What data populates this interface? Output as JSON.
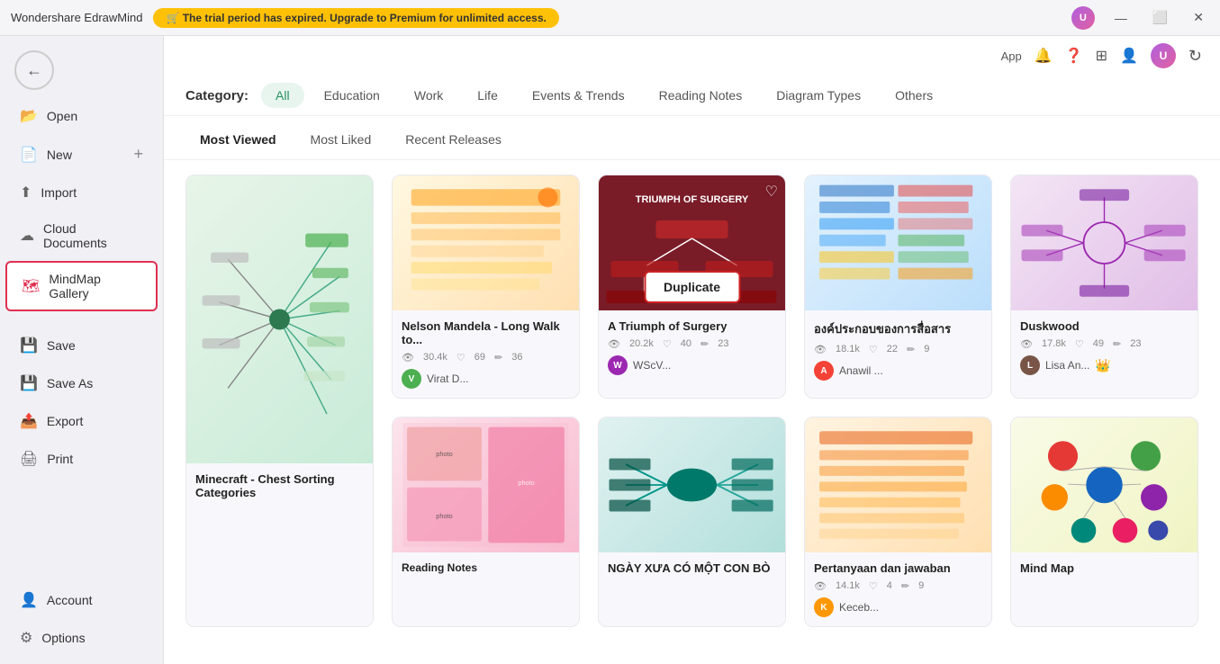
{
  "titlebar": {
    "app_name": "Wondershare EdrawMind",
    "upgrade_text": "🛒 The trial period has expired. Upgrade to Premium for unlimited access.",
    "win_btns": [
      "—",
      "⬜",
      "✕"
    ]
  },
  "toolbar": {
    "app_label": "App",
    "icons": [
      "🔔",
      "❓",
      "⊞",
      "👤"
    ]
  },
  "sidebar": {
    "items": [
      {
        "id": "open",
        "label": "Open",
        "icon": "📂"
      },
      {
        "id": "new",
        "label": "New",
        "icon": "📄",
        "extra": "+"
      },
      {
        "id": "import",
        "label": "Import",
        "icon": "⬆"
      },
      {
        "id": "cloud",
        "label": "Cloud Documents",
        "icon": "☁"
      },
      {
        "id": "gallery",
        "label": "MindMap Gallery",
        "icon": "🗺",
        "active": true
      }
    ],
    "bottom_items": [
      {
        "id": "save",
        "label": "Save",
        "icon": "💾"
      },
      {
        "id": "saveas",
        "label": "Save As",
        "icon": "💾"
      },
      {
        "id": "export",
        "label": "Export",
        "icon": "📤"
      },
      {
        "id": "print",
        "label": "Print",
        "icon": "🖨"
      }
    ],
    "footer_items": [
      {
        "id": "account",
        "label": "Account",
        "icon": "👤"
      },
      {
        "id": "options",
        "label": "Options",
        "icon": "⚙"
      }
    ]
  },
  "category": {
    "label": "Category:",
    "items": [
      {
        "id": "all",
        "label": "All",
        "active": true
      },
      {
        "id": "education",
        "label": "Education"
      },
      {
        "id": "work",
        "label": "Work"
      },
      {
        "id": "life",
        "label": "Life"
      },
      {
        "id": "events",
        "label": "Events & Trends"
      },
      {
        "id": "reading",
        "label": "Reading Notes"
      },
      {
        "id": "diagram",
        "label": "Diagram Types"
      },
      {
        "id": "others",
        "label": "Others"
      }
    ]
  },
  "filters": {
    "items": [
      {
        "id": "most_viewed",
        "label": "Most Viewed",
        "active": true
      },
      {
        "id": "most_liked",
        "label": "Most Liked"
      },
      {
        "id": "recent",
        "label": "Recent Releases"
      }
    ]
  },
  "gallery": {
    "cards": [
      {
        "id": "card1",
        "title": "Minecraft - Chest Sorting Categories",
        "views": "—",
        "likes": "—",
        "edits": "—",
        "author": "—",
        "author_color": "#888",
        "thumb_class": "mindmap-1",
        "col": 1
      },
      {
        "id": "card2",
        "title": "Nelson Mandela - Long Walk to...",
        "views": "30.4k",
        "likes": "69",
        "edits": "36",
        "author": "Virat D...",
        "author_color": "#4caf50",
        "author_initial": "V",
        "thumb_class": "mindmap-2",
        "col": 2
      },
      {
        "id": "card3",
        "title": "A Triumph of Surgery",
        "views": "20.2k",
        "likes": "40",
        "edits": "23",
        "author": "WScV...",
        "author_color": "#9c27b0",
        "author_initial": "W",
        "thumb_class": "mindmap-3",
        "col": 3,
        "has_duplicate": true,
        "has_heart": true
      },
      {
        "id": "card4",
        "title": "องค์ประกอบของการสื่อสาร",
        "views": "18.1k",
        "likes": "22",
        "edits": "9",
        "author": "Anawil ...",
        "author_color": "#f44336",
        "author_initial": "A",
        "thumb_class": "mindmap-4",
        "col": 4
      },
      {
        "id": "card5",
        "title": "Duskwood",
        "views": "17.8k",
        "likes": "49",
        "edits": "23",
        "author": "Lisa An...",
        "author_color": "#795548",
        "author_initial": "L",
        "thumb_class": "mindmap-5",
        "col": 5,
        "has_crown": true
      },
      {
        "id": "card6",
        "title": "NGÀY XƯA CÓ MỘT CON BÒ",
        "views": "—",
        "likes": "—",
        "edits": "—",
        "author": "—",
        "author_color": "#888",
        "thumb_class": "mindmap-8",
        "col": 3
      },
      {
        "id": "card7",
        "title": "Pertanyaan dan jawaban",
        "views": "14.1k",
        "likes": "4",
        "edits": "9",
        "author": "Keceb...",
        "author_color": "#ff9800",
        "author_initial": "K",
        "thumb_class": "mindmap-9",
        "col": 4
      },
      {
        "id": "card8",
        "title": "Mind Map",
        "views": "—",
        "likes": "—",
        "edits": "—",
        "author": "—",
        "author_color": "#888",
        "thumb_class": "mindmap-10",
        "col": 5
      }
    ]
  },
  "icons": {
    "back": "←",
    "cart": "🛒",
    "bell": "🔔",
    "question": "❓",
    "apps": "⊞",
    "user": "👤",
    "refresh": "↻",
    "heart": "♡",
    "eye": "👁",
    "heart_filled": "❤",
    "crown": "👑"
  }
}
